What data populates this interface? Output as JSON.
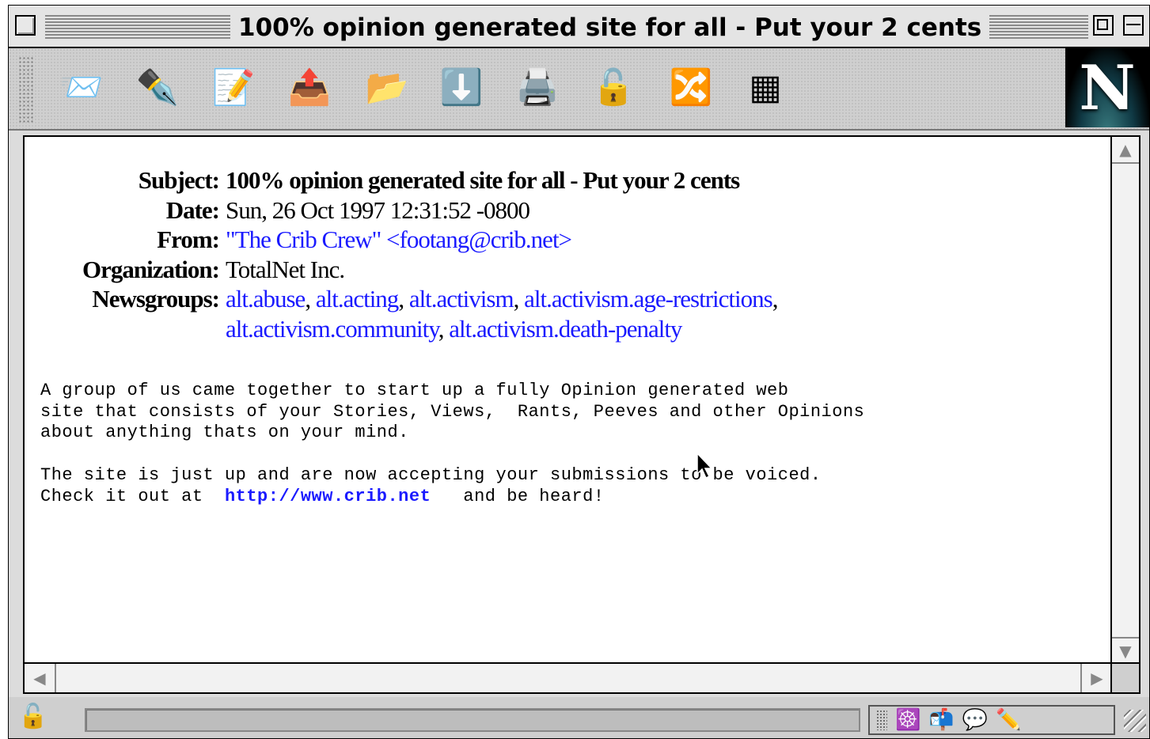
{
  "window": {
    "title": "100% opinion generated site for all - Put your 2 cents"
  },
  "toolbar": {
    "buttons": [
      {
        "name": "get-mail",
        "icon": "get-mail-icon",
        "glyph": "📨"
      },
      {
        "name": "compose",
        "icon": "compose-icon",
        "glyph": "✒️"
      },
      {
        "name": "reply",
        "icon": "reply-icon",
        "glyph": "📝"
      },
      {
        "name": "forward",
        "icon": "forward-icon",
        "glyph": "📤"
      },
      {
        "name": "file",
        "icon": "file-icon",
        "glyph": "📂"
      },
      {
        "name": "next",
        "icon": "next-icon",
        "glyph": "⬇️"
      },
      {
        "name": "print",
        "icon": "print-icon",
        "glyph": "🖨️"
      },
      {
        "name": "security",
        "icon": "security-icon",
        "glyph": "🔓"
      },
      {
        "name": "mark",
        "icon": "mark-icon",
        "glyph": "🔀"
      },
      {
        "name": "stop",
        "icon": "stop-icon",
        "glyph": "▦"
      }
    ],
    "logo": "N"
  },
  "message": {
    "headers": {
      "subject_label": "Subject:",
      "subject": "100% opinion generated site for all - Put your 2 cents",
      "date_label": "Date:",
      "date": "Sun, 26 Oct 1997 12:31:52 -0800",
      "from_label": "From:",
      "from": "\"The Crib Crew\" <footang@crib.net>",
      "organization_label": "Organization:",
      "organization": "TotalNet Inc.",
      "newsgroups_label": "Newsgroups:",
      "newsgroups": [
        "alt.abuse",
        "alt.acting",
        "alt.activism",
        "alt.activism.age-restrictions",
        "alt.activism.community",
        "alt.activism.death-penalty"
      ]
    },
    "body": {
      "line1": "A group of us came together to start up a fully Opinion generated web",
      "line2": "site that consists of your Stories, Views,  Rants, Peeves and other Opinions",
      "line3": "about anything thats on your mind.",
      "line4": "The site is just up and are now accepting your submissions to be voiced.",
      "line5_prefix": "Check it out at  ",
      "url": "http://www.crib.net",
      "line5_suffix": "   and be heard!"
    }
  },
  "statusbar": {
    "lock_icon": "unlocked-padlock-icon",
    "status_text": "",
    "components": [
      "navigator-icon",
      "mail-icon",
      "newsgroups-icon",
      "address-book-icon",
      "composer-icon"
    ]
  },
  "colors": {
    "link": "#1a1aff",
    "chrome": "#cfcfcf"
  }
}
